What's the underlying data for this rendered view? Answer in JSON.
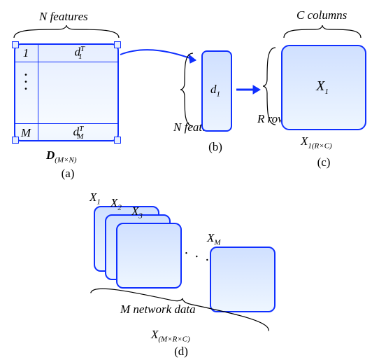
{
  "labels": {
    "N_features": "N features",
    "N_features_side": "N features",
    "C_columns": "C columns",
    "R_rows": "R rows",
    "M_network": "M network data",
    "a": "(a)",
    "b": "(b)",
    "c": "(c)",
    "d": "(d)"
  },
  "panelA": {
    "row1_index": "1",
    "row1_label_html": "d₁ᵀ",
    "rowM_index": "M",
    "rowM_label_html": "d_Mᵀ",
    "caption_html": "D_(M×N)"
  },
  "panelB": {
    "vec_label_html": "d₁"
  },
  "panelC": {
    "mat_label_html": "X₁",
    "caption_html": "X₁ (R×C)"
  },
  "panelD": {
    "stack_labels": [
      "X₁",
      "X₂",
      "X₃",
      "Xᴹ"
    ],
    "caption_html": "X_(M×R×C)"
  }
}
